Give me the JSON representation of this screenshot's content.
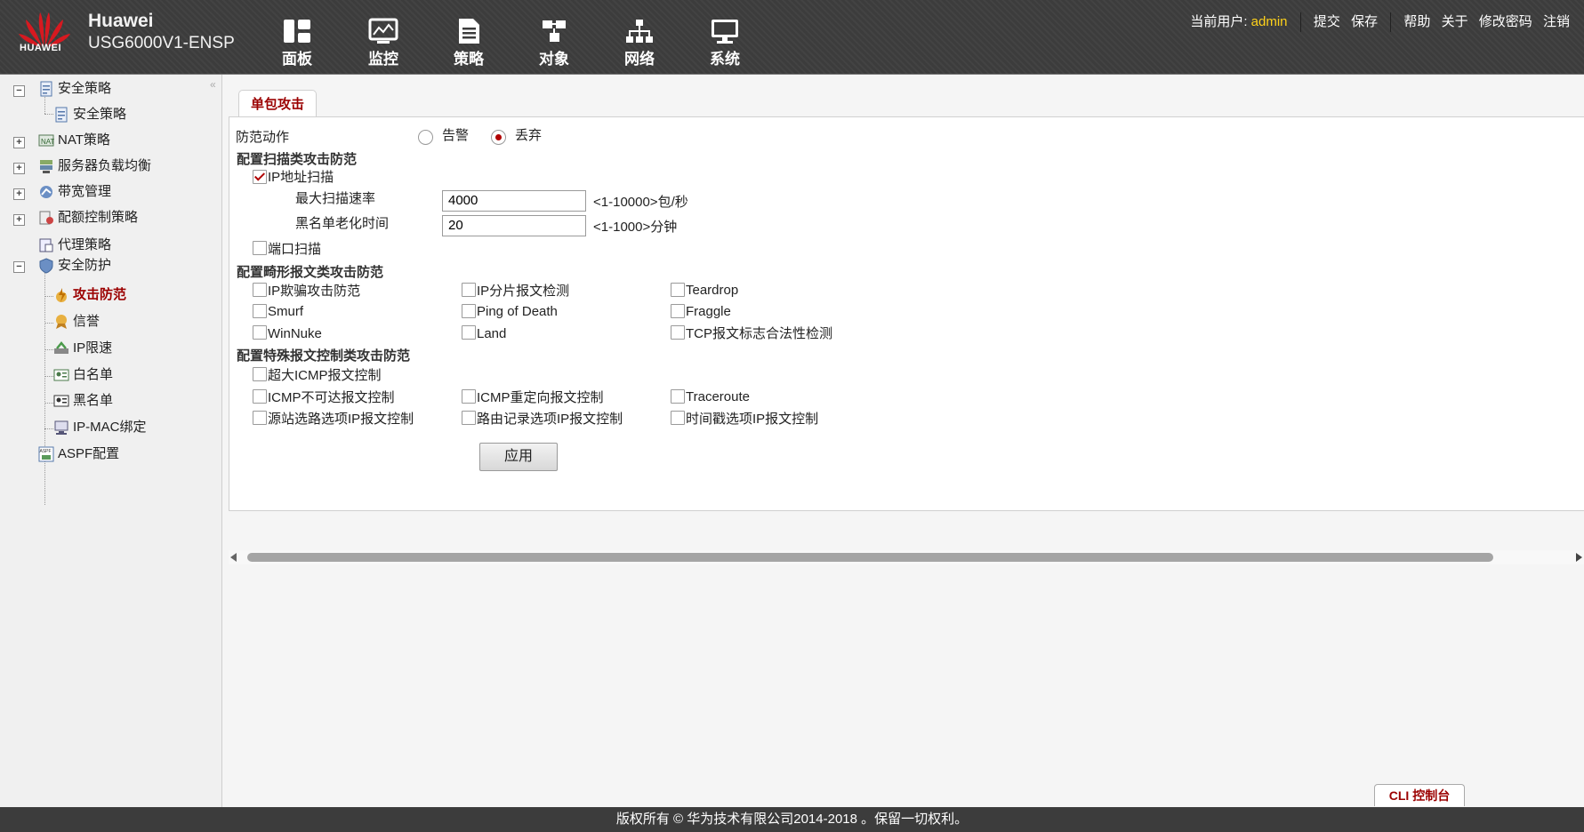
{
  "header": {
    "brand_name": "Huawei",
    "device_name": "USG6000V1-ENSP",
    "logo_text": "HUAWEI",
    "nav": [
      {
        "label": "面板",
        "icon": "dashboard-icon"
      },
      {
        "label": "监控",
        "icon": "monitor-icon"
      },
      {
        "label": "策略",
        "icon": "policy-icon"
      },
      {
        "label": "对象",
        "icon": "object-icon"
      },
      {
        "label": "网络",
        "icon": "network-icon"
      },
      {
        "label": "系统",
        "icon": "system-icon"
      }
    ],
    "user_label": "当前用户:",
    "user_name": "admin",
    "links": {
      "submit": "提交",
      "save": "保存",
      "help": "帮助",
      "about": "关于",
      "change_password": "修改密码",
      "logout": "注销"
    }
  },
  "sidebar": {
    "items": [
      {
        "label": "安全策略",
        "icon": "security-policy-icon",
        "expander": "−"
      },
      {
        "label": "安全策略",
        "icon": "security-policy-icon"
      },
      {
        "label": "NAT策略",
        "icon": "nat-icon",
        "expander": "+"
      },
      {
        "label": "服务器负载均衡",
        "icon": "server-lb-icon",
        "expander": "+"
      },
      {
        "label": "带宽管理",
        "icon": "bandwidth-icon",
        "expander": "+"
      },
      {
        "label": "配额控制策略",
        "icon": "quota-icon",
        "expander": "+"
      },
      {
        "label": "代理策略",
        "icon": "proxy-icon"
      },
      {
        "label": "安全防护",
        "icon": "shield-icon",
        "expander": "−"
      },
      {
        "label": "攻击防范",
        "icon": "attack-defense-icon"
      },
      {
        "label": "信誉",
        "icon": "reputation-icon"
      },
      {
        "label": "IP限速",
        "icon": "ip-rate-limit-icon"
      },
      {
        "label": "白名单",
        "icon": "whitelist-icon"
      },
      {
        "label": "黑名单",
        "icon": "blacklist-icon"
      },
      {
        "label": "IP-MAC绑定",
        "icon": "ip-mac-binding-icon"
      },
      {
        "label": "ASPF配置",
        "icon": "aspf-icon"
      }
    ]
  },
  "tab": {
    "label": "单包攻击"
  },
  "form": {
    "action_label": "防范动作",
    "action_options": [
      "告警",
      "丢弃"
    ],
    "action_selected": "丢弃",
    "scan_section": "配置扫描类攻击防范",
    "ip_scan": {
      "label": "IP地址扫描",
      "checked": true
    },
    "max_rate": {
      "label": "最大扫描速率",
      "value": "4000",
      "hint": "<1-10000>包/秒"
    },
    "blacklist_age": {
      "label": "黑名单老化时间",
      "value": "20",
      "hint": "<1-1000>分钟"
    },
    "port_scan": {
      "label": "端口扫描",
      "checked": false
    },
    "malformed_section": "配置畸形报文类攻击防范",
    "malformed": [
      {
        "label": "IP欺骗攻击防范",
        "checked": false
      },
      {
        "label": "IP分片报文检测",
        "checked": false
      },
      {
        "label": "Teardrop",
        "checked": false
      },
      {
        "label": "Smurf",
        "checked": false
      },
      {
        "label": "Ping of Death",
        "checked": false
      },
      {
        "label": "Fraggle",
        "checked": false
      },
      {
        "label": "WinNuke",
        "checked": false
      },
      {
        "label": "Land",
        "checked": false
      },
      {
        "label": "TCP报文标志合法性检测",
        "checked": false
      }
    ],
    "special_section": "配置特殊报文控制类攻击防范",
    "special": [
      {
        "label": "超大ICMP报文控制",
        "checked": false
      },
      {
        "label": "ICMP不可达报文控制",
        "checked": false
      },
      {
        "label": "ICMP重定向报文控制",
        "checked": false
      },
      {
        "label": "Traceroute",
        "checked": false
      },
      {
        "label": "源站选路选项IP报文控制",
        "checked": false
      },
      {
        "label": "路由记录选项IP报文控制",
        "checked": false
      },
      {
        "label": "时间戳选项IP报文控制",
        "checked": false
      }
    ],
    "apply_label": "应用"
  },
  "cli_label": "CLI 控制台",
  "footer": "版权所有 © 华为技术有限公司2014-2018 。保留一切权利。",
  "colors": {
    "accent": "#9b0000",
    "user": "#ffd21a",
    "header_bg": "#3c3c3c"
  }
}
